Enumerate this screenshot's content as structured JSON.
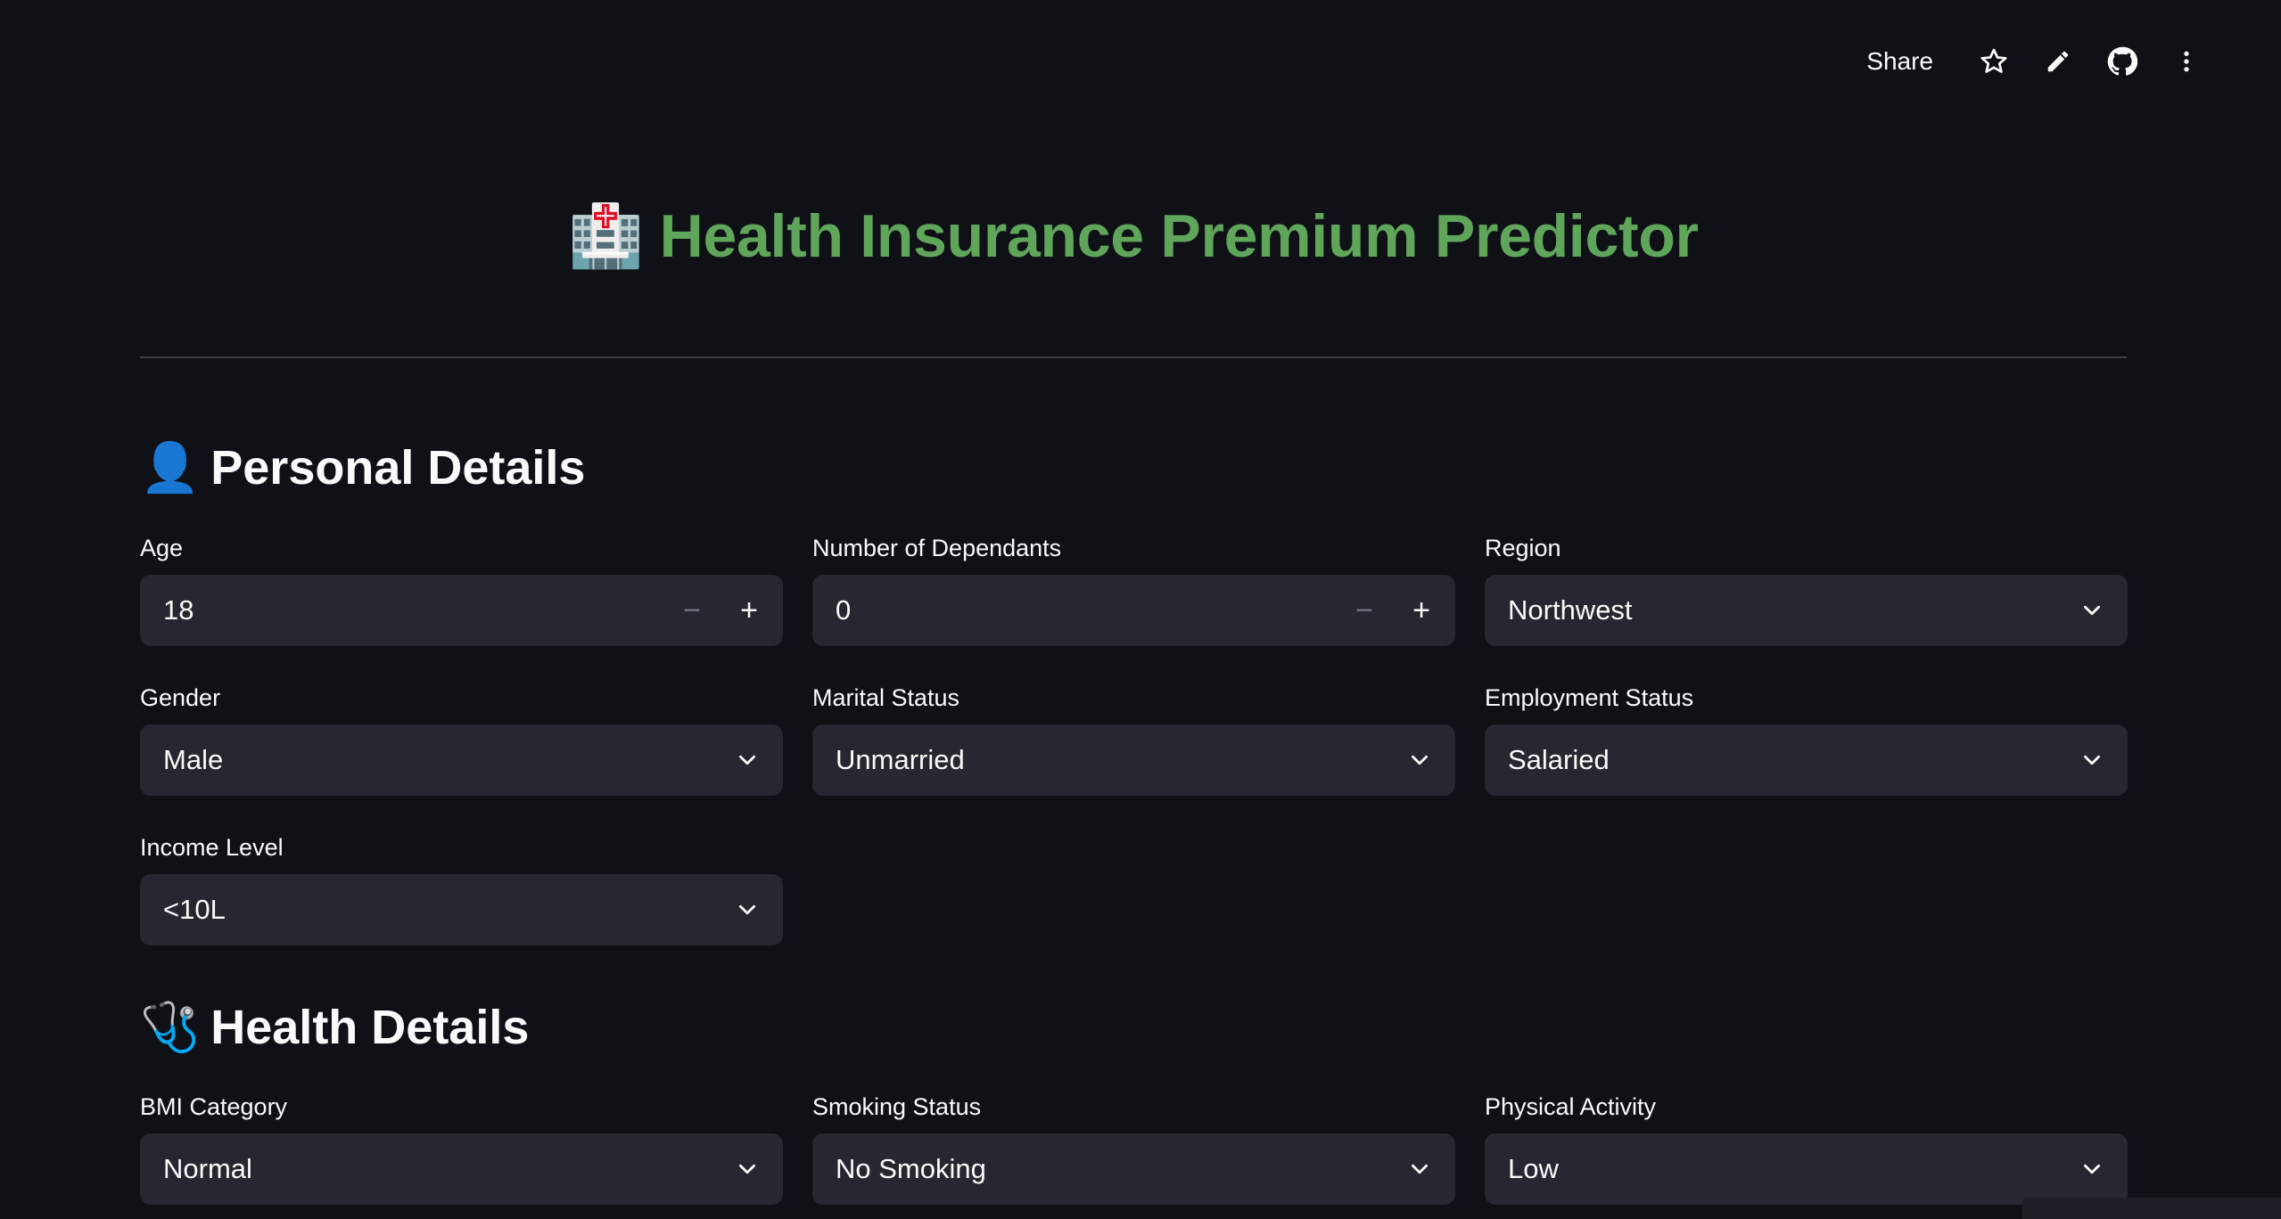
{
  "toolbar": {
    "share_label": "Share",
    "icons": [
      "star-icon",
      "pencil-icon",
      "github-icon",
      "more-vert-icon"
    ]
  },
  "title": {
    "emoji": "🏥",
    "text": "Health Insurance Premium Predictor",
    "color": "#5fa55a"
  },
  "sections": {
    "personal": {
      "emoji": "👤",
      "heading": "Personal Details"
    },
    "health": {
      "emoji": "🩺",
      "heading": "Health Details"
    }
  },
  "fields": {
    "age": {
      "label": "Age",
      "value": "18"
    },
    "dependants": {
      "label": "Number of Dependants",
      "value": "0"
    },
    "region": {
      "label": "Region",
      "value": "Northwest"
    },
    "gender": {
      "label": "Gender",
      "value": "Male"
    },
    "marital": {
      "label": "Marital Status",
      "value": "Unmarried"
    },
    "employment": {
      "label": "Employment Status",
      "value": "Salaried"
    },
    "income": {
      "label": "Income Level",
      "value": "<10L"
    },
    "bmi": {
      "label": "BMI Category",
      "value": "Normal"
    },
    "smoking": {
      "label": "Smoking Status",
      "value": "No Smoking"
    },
    "activity": {
      "label": "Physical Activity",
      "value": "Low"
    }
  },
  "stepper": {
    "minus": "−",
    "plus": "+"
  },
  "colors": {
    "background": "#0f1117",
    "input_bg": "#262730",
    "accent_green": "#5fa55a",
    "text": "#fafafa"
  }
}
